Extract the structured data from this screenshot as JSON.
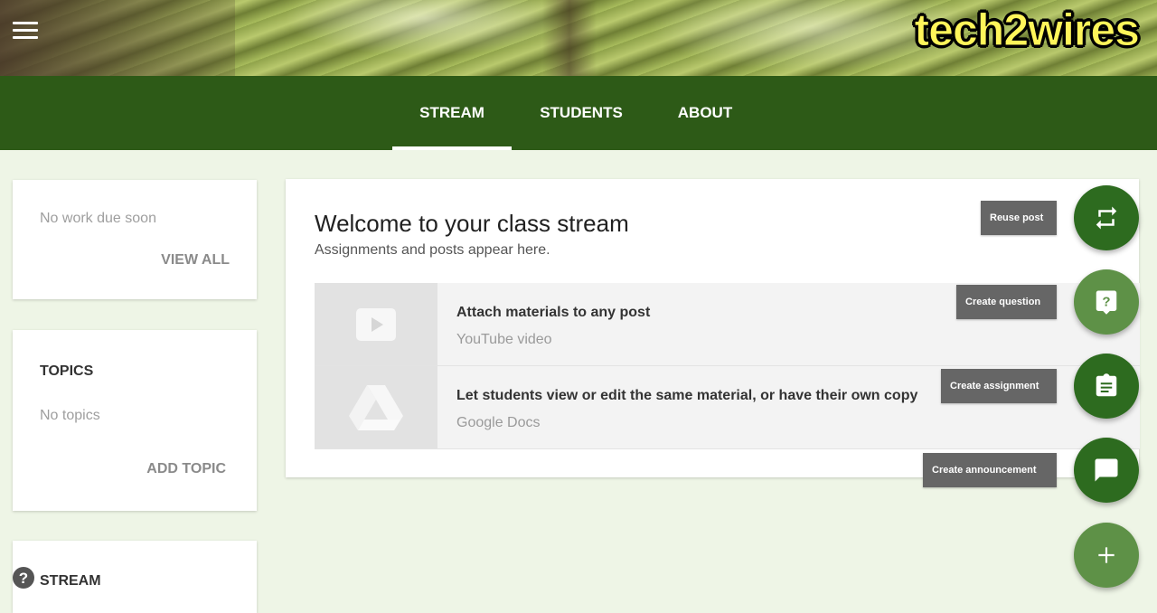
{
  "header": {
    "watermark": "tech2wires",
    "menu_icon": "hamburger-menu-icon"
  },
  "nav": {
    "tabs": [
      {
        "label": "STREAM",
        "active": true
      },
      {
        "label": "STUDENTS",
        "active": false
      },
      {
        "label": "ABOUT",
        "active": false
      }
    ]
  },
  "upcoming": {
    "status": "No work due soon",
    "view_all": "VIEW ALL"
  },
  "topics": {
    "title": "TOPICS",
    "empty": "No topics",
    "add": "ADD TOPIC"
  },
  "stream_card": {
    "label": "STREAM",
    "help_icon": "help-circle-icon"
  },
  "main": {
    "title": "Welcome to your class stream",
    "subtitle": "Assignments and posts appear here.",
    "tips": [
      {
        "title": "Attach materials to any post",
        "sub": "YouTube video",
        "icon": "youtube-icon"
      },
      {
        "title": "Let students view or edit the same material, or have their own copy",
        "sub": "Google Docs",
        "icon": "google-drive-icon"
      }
    ]
  },
  "actions": {
    "reuse": "Reuse post",
    "question": "Create question",
    "assignment": "Create assignment",
    "announcement": "Create announcement",
    "add_icon": "plus-icon"
  },
  "colors": {
    "nav_bg": "#2d5a17",
    "fab_dark": "#2d6b1f",
    "fab_light": "#5e9147",
    "page_bg": "#eef5e6",
    "watermark": "#fff55a"
  }
}
